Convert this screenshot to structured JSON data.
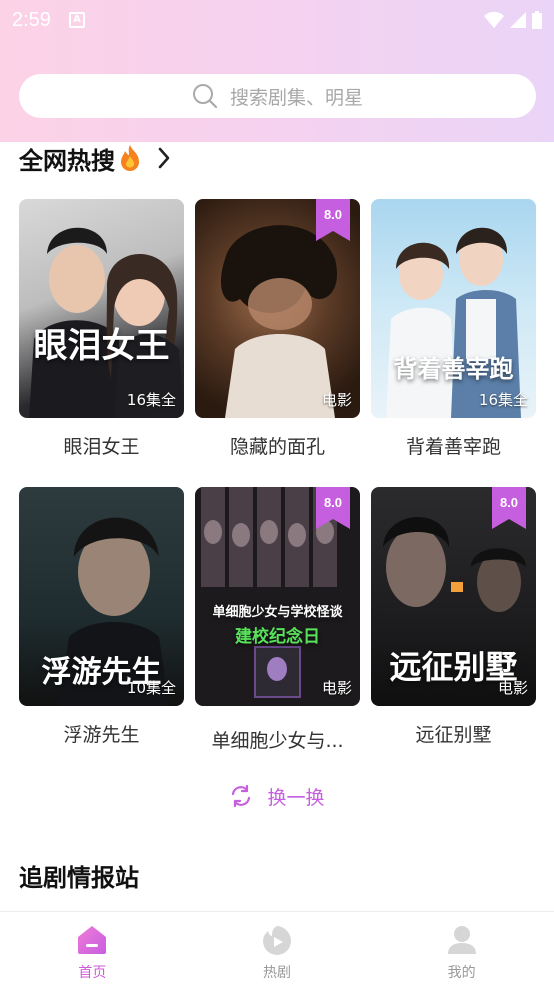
{
  "status_bar": {
    "time": "2:59",
    "notif_letter": "A"
  },
  "search": {
    "placeholder": "搜索剧集、明星"
  },
  "hot_section": {
    "title": "全网热搜"
  },
  "cards": [
    {
      "title": "眼泪女王",
      "tag": "16集全",
      "overlay": "眼泪女王",
      "rating": ""
    },
    {
      "title": "隐藏的面孔",
      "tag": "电影",
      "overlay": "",
      "rating": "8.0"
    },
    {
      "title": "背着善宰跑",
      "tag": "16集全",
      "overlay": "背着善宰跑",
      "rating": ""
    },
    {
      "title": "浮游先生",
      "tag": "10集全",
      "overlay": "浮游先生",
      "rating": ""
    },
    {
      "title": "单细胞少女与...",
      "tag": "电影",
      "overlay": "单细胞少女与学校怪谈",
      "overlay2": "建校纪念日",
      "rating": "8.0"
    },
    {
      "title": "远征别墅",
      "tag": "电影",
      "overlay": "远征别墅",
      "rating": "8.0"
    }
  ],
  "refresh": {
    "label": "换一换"
  },
  "news_section": {
    "title": "追剧情报站"
  },
  "tabs": [
    {
      "label": "首页",
      "icon": "home-icon",
      "active": true
    },
    {
      "label": "热剧",
      "icon": "play-icon",
      "active": false
    },
    {
      "label": "我的",
      "icon": "user-icon",
      "active": false
    }
  ],
  "colors": {
    "accent": "#d15ad9",
    "rating_bg": "#c65ee0"
  }
}
